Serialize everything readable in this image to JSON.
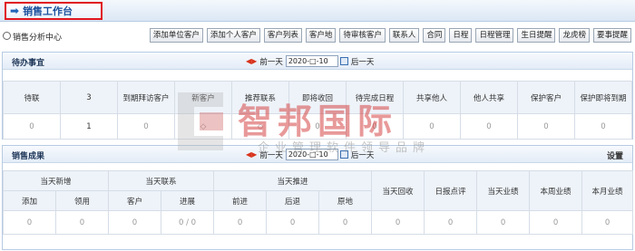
{
  "header": {
    "title": "销售工作台"
  },
  "toolbar": {
    "radio_label": "销售分析中心",
    "buttons": [
      "添加单位客户",
      "添加个人客户",
      "客户列表",
      "客户地",
      "待审核客户",
      "联系人",
      "合同",
      "日程",
      "日程管理",
      "生日提醒",
      "龙虎榜",
      "要事提醒"
    ]
  },
  "todo": {
    "title": "待办事宜",
    "prev_label": "前一天",
    "next_label": "后一天",
    "date": "2020-□-10",
    "columns": [
      "待联",
      "3",
      "到期拜访客户",
      "新客户",
      "推荐联系",
      "即将收回",
      "待完成日程",
      "共享他人",
      "他人共享",
      "保护客户",
      "保护即将到期"
    ],
    "values": [
      "0",
      "1",
      "0",
      "◇",
      "◇",
      "0",
      "0",
      "0",
      "0",
      "0",
      "0"
    ]
  },
  "results": {
    "title": "销售成果",
    "prev_label": "前一天",
    "next_label": "后一天",
    "date": "2020-□-10",
    "settings_label": "设置",
    "group_headers": [
      "当天新增",
      "当天联系",
      "当天推进",
      "当天回收",
      "日报点评",
      "当天业绩",
      "本周业绩",
      "本月业绩"
    ],
    "sub_headers": [
      "添加",
      "领用",
      "客户",
      "进展",
      "前进",
      "后退",
      "原地"
    ],
    "values": [
      "0",
      "0",
      "0",
      "0 / 0",
      "0",
      "0",
      "0",
      "0",
      "0",
      "0",
      "0",
      "0"
    ]
  },
  "watermark": {
    "main": "智邦国际",
    "sub": "企业管理软件领导品牌"
  }
}
